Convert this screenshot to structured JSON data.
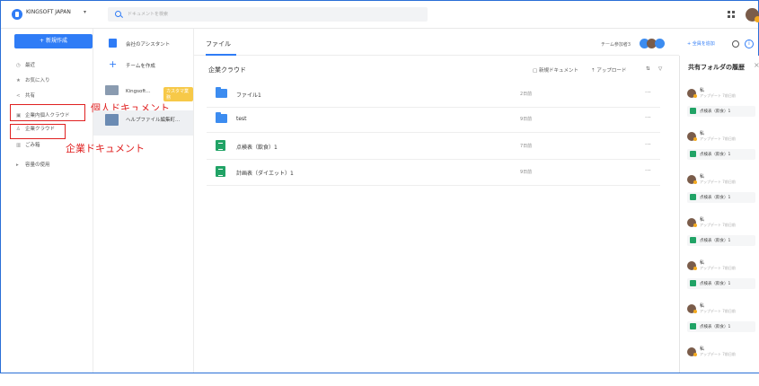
{
  "topbar": {
    "org_name": "KINGSOFT JAPAN",
    "org_caret": "▾",
    "search_placeholder": "ドキュメントを検索"
  },
  "sidebar": {
    "new_button": "+ 新規作成",
    "items": [
      {
        "icon": "clock-icon",
        "glyph": "◷",
        "label": "最近"
      },
      {
        "icon": "star-icon",
        "glyph": "★",
        "label": "お気に入り"
      },
      {
        "icon": "share-icon",
        "glyph": "<",
        "label": "共有"
      },
      {
        "icon": "personal-doc-icon",
        "glyph": "▣",
        "label": "企業内個人クラウド"
      },
      {
        "icon": "company-cloud-icon",
        "glyph": "♙",
        "label": "企業クラウド"
      },
      {
        "icon": "trash-icon",
        "glyph": "▥",
        "label": "ごみ箱"
      },
      {
        "icon": "expand-icon",
        "glyph": "▸",
        "label": "容量の使用"
      }
    ]
  },
  "annotations": {
    "personal": "個人ドキュメント",
    "company": "企業ドキュメント"
  },
  "col2": {
    "items": [
      {
        "label": "会社のアシスタント"
      },
      {
        "label": "チームを作成"
      },
      {
        "label": "Kingsoft...",
        "tag": "カスタマ業務"
      },
      {
        "label": "ヘルプファイル編集町..."
      }
    ]
  },
  "main": {
    "tab": "ファイル",
    "members_label": "チーム参加者3",
    "add_member": "+ 全員を追加",
    "section_title": "企業クラウド",
    "tools": {
      "new_doc": "新規ドキュメント",
      "upload": "アップロード"
    },
    "files": [
      {
        "type": "folder",
        "name": "ファイル1",
        "date": "2日前"
      },
      {
        "type": "folder",
        "name": "test",
        "date": "9日前"
      },
      {
        "type": "sheet",
        "name": "点検表（飲食）1",
        "date": "7日前"
      },
      {
        "type": "sheet",
        "name": "計画表（ダイエット）1",
        "date": "9日前"
      }
    ],
    "more": "···"
  },
  "rpanel": {
    "title": "共有フォルダの履歴",
    "close": "×",
    "entries": [
      {
        "user": "私",
        "action": "アップデート 7前日前",
        "file": "点検表（飲食）1"
      },
      {
        "user": "私",
        "action": "アップデート 7前日前",
        "file": "点検表（飲食）1"
      },
      {
        "user": "私",
        "action": "アップデート 7前日前",
        "file": "点検表（飲食）1"
      },
      {
        "user": "私",
        "action": "アップデート 7前日前",
        "file": "点検表（飲食）1"
      },
      {
        "user": "私",
        "action": "アップデート 7前日前",
        "file": "点検表（飲食）1"
      },
      {
        "user": "私",
        "action": "アップデート 7前日前",
        "file": "点検表（飲食）1"
      },
      {
        "user": "私",
        "action": "アップデート 7前日前",
        "file": ""
      }
    ]
  },
  "colors": {
    "accent": "#2f7cf6",
    "annotation": "#e02020",
    "sheet": "#21a366"
  }
}
